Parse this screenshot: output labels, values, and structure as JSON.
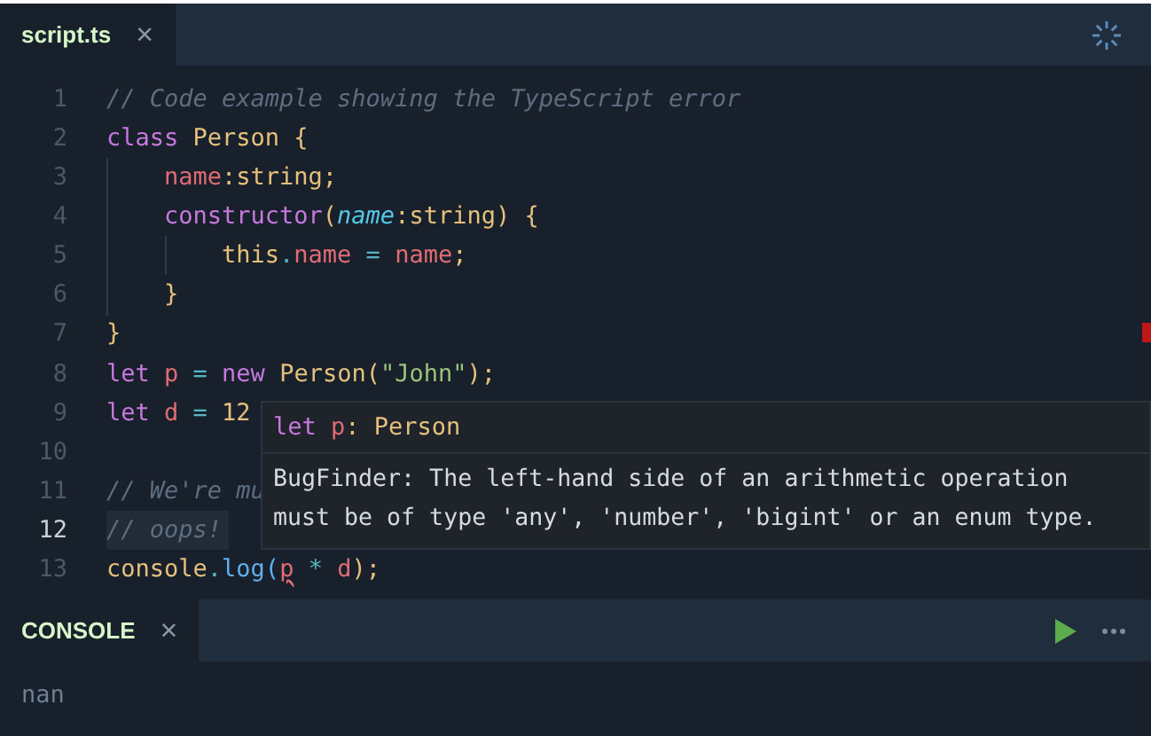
{
  "tabs": [
    {
      "label": "script.ts",
      "close": "×",
      "selected": true
    }
  ],
  "lines": [
    {
      "number": "1",
      "current": false,
      "tokens": [
        {
          "kind": "comment",
          "text": "// Code example showing the TypeScript error"
        }
      ]
    },
    {
      "number": "2",
      "current": false,
      "tokens": [
        {
          "kind": "keyword",
          "text": "class "
        },
        {
          "kind": "type",
          "text": "Person {"
        }
      ]
    },
    {
      "number": "3",
      "current": false,
      "tokens": [
        {
          "kind": "prop",
          "text": "    name"
        },
        {
          "kind": "type",
          "text": ":string;"
        }
      ]
    },
    {
      "number": "4",
      "current": false,
      "tokens": [
        {
          "kind": "keyword",
          "text": "    constructor"
        },
        {
          "kind": "type",
          "text": "("
        },
        {
          "kind": "param",
          "text": "name"
        },
        {
          "kind": "type",
          "text": ":string) {"
        }
      ]
    },
    {
      "number": "5",
      "current": false,
      "tokens": [
        {
          "kind": "type",
          "text": "        this"
        },
        {
          "kind": "op",
          "text": "."
        },
        {
          "kind": "prop",
          "text": "name"
        },
        {
          "kind": "op",
          "text": " = "
        },
        {
          "kind": "prop",
          "text": "name"
        },
        {
          "kind": "type",
          "text": ";"
        }
      ]
    },
    {
      "number": "6",
      "current": false,
      "tokens": [
        {
          "kind": "type",
          "text": "    }"
        }
      ]
    },
    {
      "number": "7",
      "current": false,
      "tokens": [
        {
          "kind": "type",
          "text": "}"
        }
      ]
    },
    {
      "number": "8",
      "current": false,
      "tokens": [
        {
          "kind": "keyword",
          "text": "let "
        },
        {
          "kind": "prop",
          "text": "p"
        },
        {
          "kind": "op",
          "text": " = "
        },
        {
          "kind": "keyword",
          "text": "new "
        },
        {
          "kind": "type",
          "text": "Person("
        },
        {
          "kind": "string",
          "text": "\"John\""
        },
        {
          "kind": "type",
          "text": ");"
        }
      ]
    },
    {
      "number": "9",
      "current": false,
      "tokens": [
        {
          "kind": "keyword",
          "text": "let "
        },
        {
          "kind": "prop",
          "text": "d"
        },
        {
          "kind": "op",
          "text": " = "
        },
        {
          "kind": "type",
          "text": "12"
        }
      ]
    },
    {
      "number": "10",
      "current": false
    },
    {
      "number": "11",
      "current": false,
      "tokens": [
        {
          "kind": "comment",
          "text": "// We're mu"
        }
      ]
    },
    {
      "number": "12",
      "current": true,
      "tokens": [
        {
          "kind": "comment",
          "text": "// oops!"
        }
      ]
    },
    {
      "number": "13",
      "current": false,
      "tokens": [
        {
          "kind": "type",
          "text": "console"
        },
        {
          "kind": "op",
          "text": "."
        },
        {
          "kind": "func",
          "text": "log("
        },
        {
          "kind": "error",
          "text": "p"
        },
        {
          "kind": "op",
          "text": " * "
        },
        {
          "kind": "prop",
          "text": "d"
        },
        {
          "kind": "type",
          "text": ");"
        }
      ]
    }
  ],
  "tooltip": {
    "signature": [
      {
        "kind": "keyword",
        "text": "let "
      },
      {
        "kind": "prop",
        "text": "p"
      },
      {
        "kind": "type",
        "text": ": Person"
      }
    ],
    "message": "BugFinder: The left-hand side of an arithmetic operation must be of type 'any', 'number', 'bigint' or an enum type."
  },
  "panel": {
    "tabs": [
      {
        "label": "CONSOLE",
        "close": "×",
        "selected": true
      }
    ],
    "output": "nan"
  }
}
